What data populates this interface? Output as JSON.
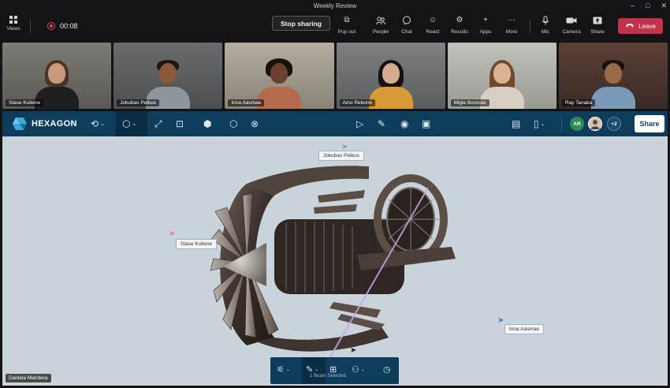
{
  "window": {
    "title": "Weekly Review",
    "controls": [
      "–",
      "□",
      "✕"
    ]
  },
  "meeting": {
    "views_label": "Views",
    "recording_time": "00:08",
    "stop_sharing_label": "Stop sharing",
    "tools": [
      {
        "label": "Pop out",
        "icon": "popout-icon",
        "glyph": "⧉"
      },
      {
        "label": "People",
        "icon": "people-icon",
        "glyph": "👥"
      },
      {
        "label": "Chat",
        "icon": "chat-icon",
        "glyph": "💬"
      },
      {
        "label": "React",
        "icon": "react-icon",
        "glyph": "☺"
      },
      {
        "label": "Results",
        "icon": "results-icon",
        "glyph": "⚙"
      },
      {
        "label": "Apps",
        "icon": "apps-icon",
        "glyph": "+"
      },
      {
        "label": "More",
        "icon": "more-icon",
        "glyph": "···"
      },
      {
        "label": "Mic",
        "icon": "mic-icon",
        "glyph": "🎤"
      },
      {
        "label": "Camera",
        "icon": "camera-icon",
        "glyph": "📹"
      },
      {
        "label": "Share",
        "icon": "share-icon",
        "glyph": "⬆"
      }
    ],
    "leave_label": "Leave"
  },
  "participants": [
    {
      "name": "Stase Kuliene",
      "bg": "#6b6a66",
      "skin": "#c99a7a",
      "hair": "#4a3426",
      "shirt": "#1e1e22"
    },
    {
      "name": "Jokubas Petkus",
      "bg": "#595a5c",
      "skin": "#8a5a3e",
      "hair": "#1d1612",
      "shirt": "#8e969c"
    },
    {
      "name": "Inna Aasmae",
      "bg": "#9a9388",
      "skin": "#6a4030",
      "hair": "#1a120e",
      "shirt": "#b46a4c"
    },
    {
      "name": "Aino Rebone",
      "bg": "#6a6c6e",
      "skin": "#d6ac90",
      "hair": "#15110f",
      "shirt": "#d79a34"
    },
    {
      "name": "Migle Bockute",
      "bg": "#a8a8a2",
      "skin": "#dcb294",
      "hair": "#6e4a2e",
      "shirt": "#d8cfc4"
    },
    {
      "name": "Ray Tanaka",
      "bg": "#4a3530",
      "skin": "#9a6a4c",
      "hair": "#1a1210",
      "shirt": "#7a9ab8"
    }
  ],
  "app": {
    "brand": "HEXAGON",
    "collaborators": {
      "initials": "AR",
      "extra_count": "+2"
    },
    "share_label": "Share"
  },
  "canvas": {
    "cursor_labels": {
      "jokubas": "Jokubas Petkus",
      "stase": "Stase Kuliene",
      "inna": "Inna Aasmae"
    },
    "presenter_name": "Daniela Mandera",
    "selection_caption": "1 Beam Selected"
  },
  "colors": {
    "leave": "#c4314b",
    "appbar": "#0e3d5c",
    "canvas": "#c9d4da",
    "avatar_ar": "#2e8b57"
  }
}
